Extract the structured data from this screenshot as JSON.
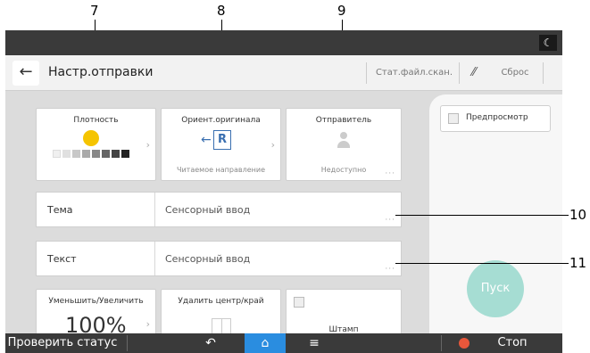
{
  "callouts": {
    "c7": "7",
    "c8": "8",
    "c9": "9",
    "c10": "10",
    "c11": "11"
  },
  "header": {
    "title": "Настр.отправки",
    "stat_button": "Стат.файл.скан.",
    "reset_button": "Сброс"
  },
  "cards": {
    "density": {
      "title": "Плотность",
      "level": 0.5
    },
    "orientation": {
      "title": "Ориент.оригинала",
      "icon_letter": "R",
      "sub": "Читаемое направление"
    },
    "sender": {
      "title": "Отправитель",
      "sub": "Недоступно"
    },
    "scale": {
      "title": "Уменьшить/Увеличить",
      "value": "100%"
    },
    "erase": {
      "title": "Удалить центр/край"
    },
    "stamp": {
      "title": "Штамп"
    }
  },
  "rows": {
    "subject": {
      "label": "Тема",
      "value": "Сенсорный ввод"
    },
    "text": {
      "label": "Текст",
      "value": "Сенсорный ввод"
    }
  },
  "right_panel": {
    "preview_label": "Предпросмотр",
    "start_label": "Пуск"
  },
  "statusbar": {
    "check_status": "Проверить статус",
    "stop": "Стоп"
  },
  "colors": {
    "start": "#a6ddd3",
    "home": "#2a8de0",
    "stop": "#e8573b",
    "bulb": "#f5c400"
  }
}
